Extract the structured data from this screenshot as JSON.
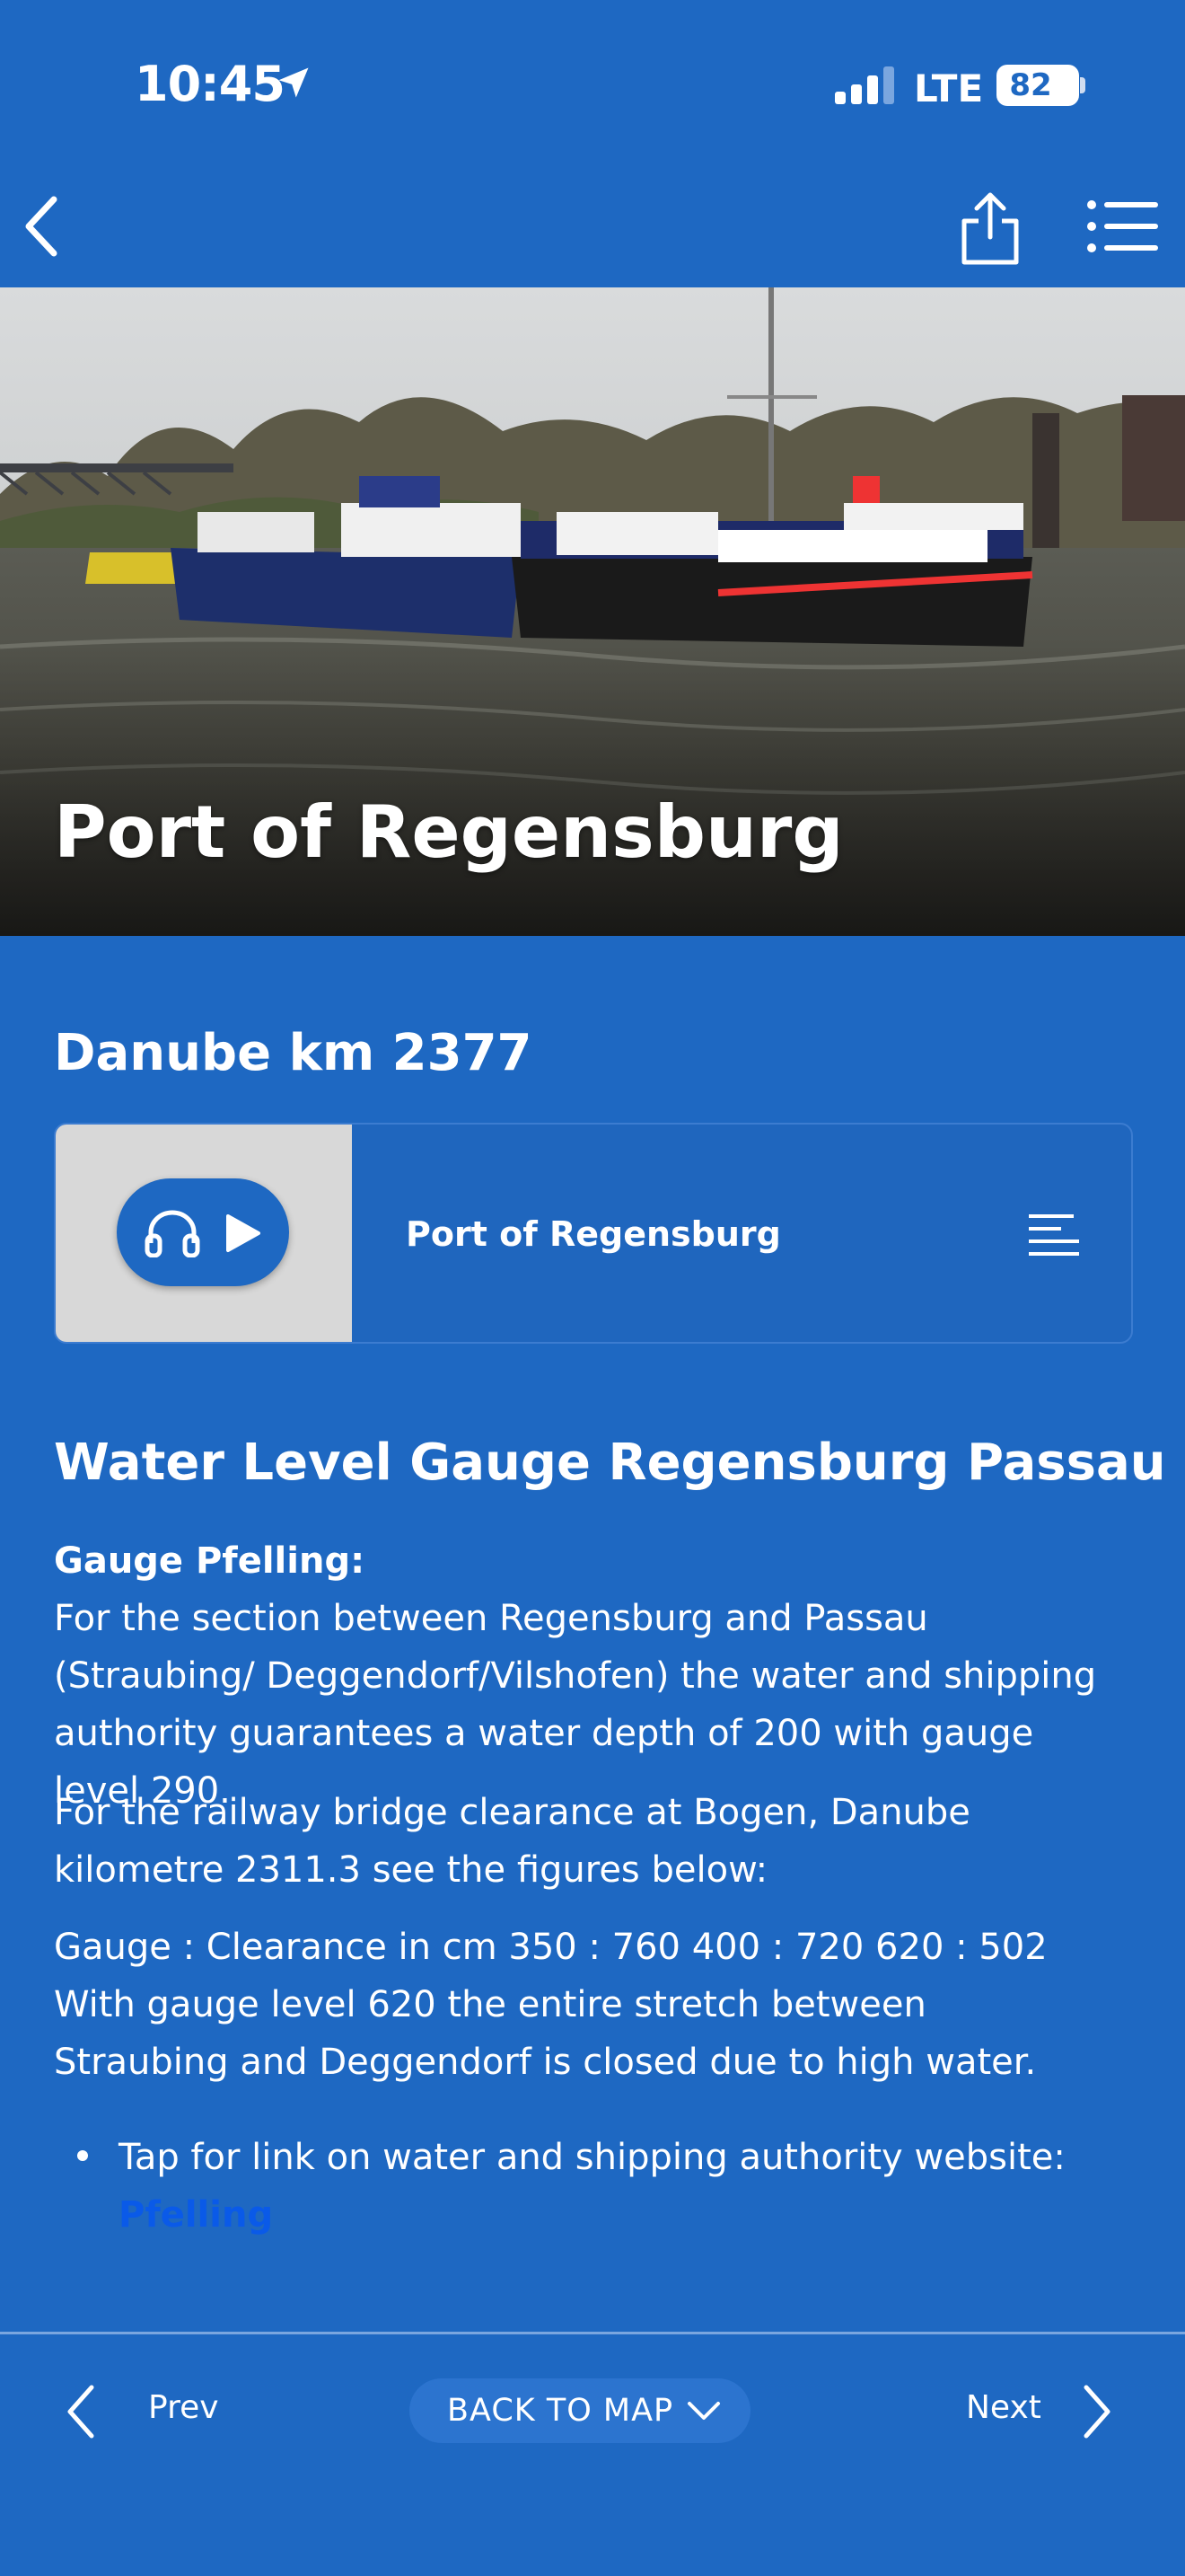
{
  "status_bar": {
    "time": "10:45",
    "network": "LTE",
    "battery": "82"
  },
  "nav": {
    "back_icon": "chevron-left-icon",
    "share_icon": "share-icon",
    "menu_icon": "list-icon"
  },
  "hero": {
    "title": "Port of Regensburg"
  },
  "content": {
    "subheading": "Danube km 2377",
    "audio": {
      "title": "Port of Regensburg",
      "icons": [
        "headphones-icon",
        "play-icon",
        "transcript-icon"
      ]
    },
    "section_title": "Water Level Gauge Regensburg Passau",
    "gauge_label": "Gauge Pfelling:",
    "paragraph_1": "For the section between Regensburg and Passau (Straubing/ Deggendorf/Vilshofen) the water and shipping authority guarantees a water depth of 200 with gauge level 290.",
    "paragraph_2": "For the railway bridge clearance at Bogen, Danube kilometre 2311.3 see the figures below:",
    "paragraph_3": "Gauge : Clearance in cm 350 : 760 400 : 720 620 : 502 With gauge level 620 the entire stretch between Straubing and Deggendorf is closed due to high water.",
    "bullet_text": "Tap for link on water and shipping authority website:",
    "bullet_link": "Pfelling"
  },
  "bottom_bar": {
    "prev_label": "Prev",
    "back_to_map_label": "BACK TO MAP",
    "next_label": "Next"
  },
  "colors": {
    "background": "#1e68c2",
    "link": "#0a5ae8",
    "thumb": "#d8d8d8"
  }
}
